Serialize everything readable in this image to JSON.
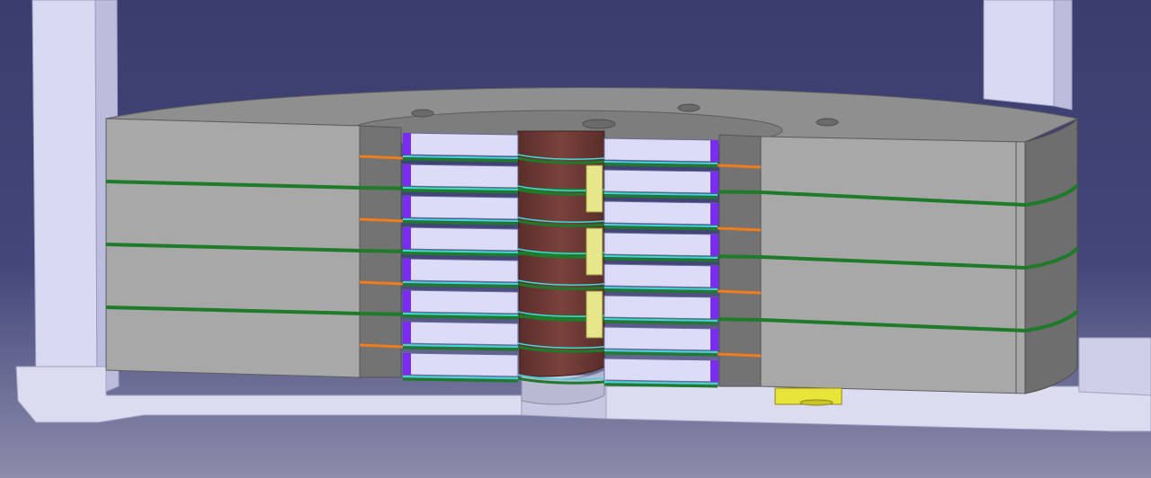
{
  "viewport": {
    "background_top": "#3b3d6e",
    "background_bottom": "#8c8cab"
  },
  "colors": {
    "support_column": "#d9d9f2",
    "support_column_shade": "#bcbcdc",
    "base_plate": "#dcdcf0",
    "base_plate_edge": "#b8b8d4",
    "housing_front": "#a8a8a8",
    "housing_side": "#6e6e6e",
    "housing_top": "#8f8f8f",
    "cavity": "#737373",
    "core_copper": "#6e3a36",
    "core_copper_dark": "#4e2724",
    "coil_face": "#dcdcf8",
    "coil_edge_violet": "#7a2cf0",
    "coil_edge_cyan": "#3fd8d8",
    "spacer_green": "#1f7a2a",
    "spacer_orange": "#f07d1c",
    "clamp_yellow": "#e6e68a",
    "foot_yellow": "#e8e43a"
  },
  "scene": {
    "object": "segmented-coil-assembly-section-view",
    "coil_rows": 8,
    "green_bands": 3,
    "clamp_blocks": 3
  }
}
